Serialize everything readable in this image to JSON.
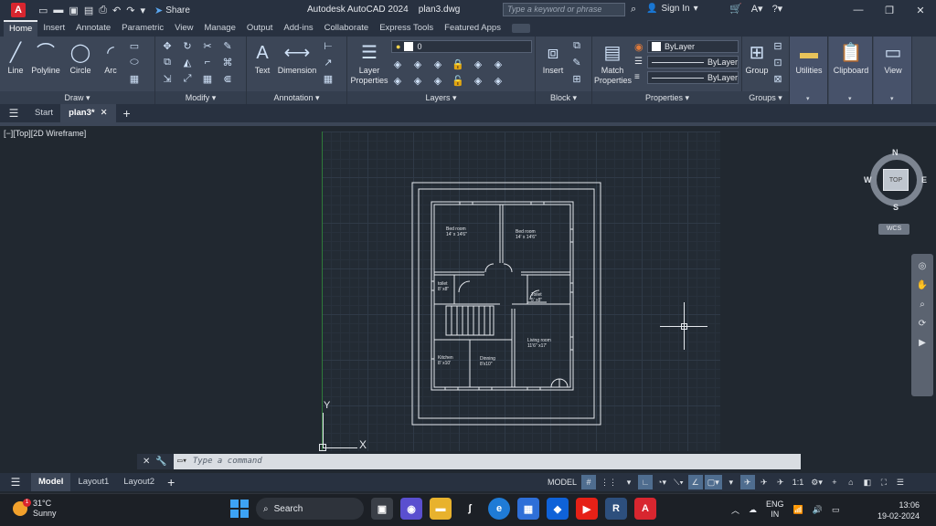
{
  "titlebar": {
    "app_logo": "A",
    "app_name": "Autodesk AutoCAD 2024",
    "file_name": "plan3.dwg",
    "share_label": "Share",
    "search_placeholder": "Type a keyword or phrase",
    "signin_label": "Sign In"
  },
  "menu_tabs": [
    "Home",
    "Insert",
    "Annotate",
    "Parametric",
    "View",
    "Manage",
    "Output",
    "Add-ins",
    "Collaborate",
    "Express Tools",
    "Featured Apps"
  ],
  "ribbon": {
    "draw": {
      "title": "Draw",
      "tools": [
        "Line",
        "Polyline",
        "Circle",
        "Arc"
      ]
    },
    "modify": {
      "title": "Modify"
    },
    "annotation": {
      "title": "Annotation",
      "tools": [
        "Text",
        "Dimension"
      ]
    },
    "layers": {
      "title": "Layers",
      "tool": "Layer Properties",
      "current_layer": "0"
    },
    "block": {
      "title": "Block",
      "tool": "Insert"
    },
    "properties": {
      "title": "Properties",
      "tool": "Match Properties",
      "color": "ByLayer",
      "linetype": "ByLayer",
      "lineweight": "ByLayer"
    },
    "groups": {
      "title": "Groups",
      "tool": "Group"
    },
    "utilities": "Utilities",
    "clipboard": "Clipboard",
    "view": "View"
  },
  "file_tabs": {
    "start": "Start",
    "active": "plan3*"
  },
  "viewport": {
    "label": "[−][Top][2D Wireframe]",
    "ucs_x": "X",
    "ucs_y": "Y",
    "viewcube": {
      "n": "N",
      "s": "S",
      "e": "E",
      "w": "W",
      "face": "TOP",
      "wcs": "WCS"
    }
  },
  "plan": {
    "rooms": [
      {
        "name": "Bed room",
        "size": "14' x 14'6\""
      },
      {
        "name": "Bed room",
        "size": "14' x 14'6\""
      },
      {
        "name": "toilet",
        "size": "8' x8\""
      },
      {
        "name": "Toilet",
        "size": "5' x8\""
      },
      {
        "name": "Living room",
        "size": "11'6\" x17'"
      },
      {
        "name": "Kitchen",
        "size": "8' x10'"
      },
      {
        "name": "Dinning",
        "size": "8'x10\""
      }
    ]
  },
  "command_line": {
    "placeholder": "Type  a  command"
  },
  "layout_tabs": [
    "Model",
    "Layout1",
    "Layout2"
  ],
  "status": {
    "model_label": "MODEL",
    "scale": "1:1"
  },
  "taskbar": {
    "temperature": "31°C",
    "weather": "Sunny",
    "badge": "1",
    "search_label": "Search",
    "lang_top": "ENG",
    "lang_bottom": "IN",
    "time": "13:06",
    "date": "19-02-2024"
  },
  "colors": {
    "accent": "#d8262f",
    "ribbon_bg": "#3c4657",
    "canvas_bg": "#212830",
    "windows_blue": "#3da3f5"
  }
}
